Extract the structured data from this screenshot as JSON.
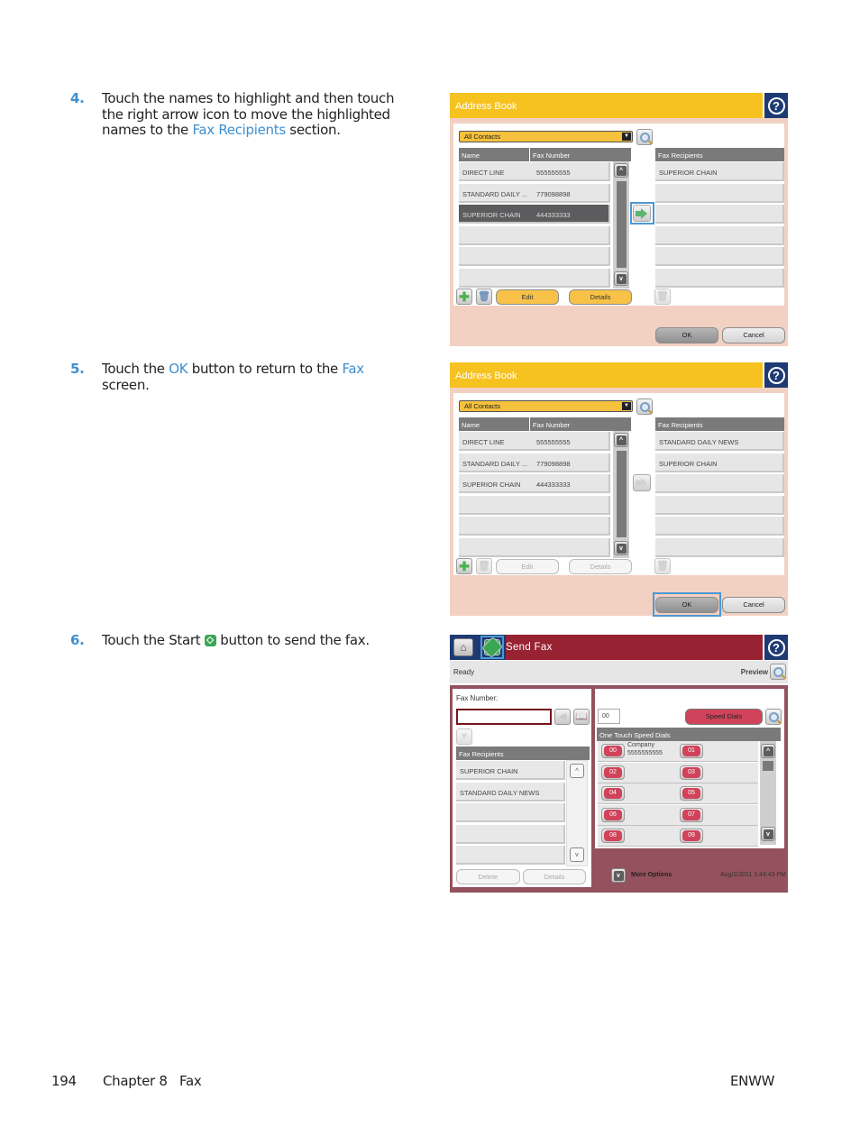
{
  "steps": [
    {
      "num": "4.",
      "parts": [
        "Touch the names to highlight and then touch the right arrow icon to move the highlighted names to the ",
        "Fax Recipients",
        " section."
      ]
    },
    {
      "num": "5.",
      "parts": [
        "Touch the ",
        "OK",
        " button to return to the ",
        "Fax",
        " screen."
      ]
    },
    {
      "num": "6.",
      "parts": [
        "Touch the Start ",
        " button to send the fax."
      ]
    }
  ],
  "footer": {
    "page": "194",
    "chapter": "Chapter 8   Fax",
    "right": "ENWW"
  },
  "address_book_1": {
    "title": "Address Book",
    "filter": "All Contacts",
    "columns": {
      "name": "Name",
      "fax": "Fax Number",
      "recipients": "Fax Recipients"
    },
    "contacts": [
      {
        "name": "DIRECT LINE",
        "fax": "555555555",
        "selected": false
      },
      {
        "name": "STANDARD DAILY ...",
        "fax": "779098898",
        "selected": false
      },
      {
        "name": "SUPERIOR CHAIN",
        "fax": "444333333",
        "selected": true
      }
    ],
    "recipients": [
      "SUPERIOR CHAIN"
    ],
    "edit": "Edit",
    "details": "Details",
    "ok": "OK",
    "cancel": "Cancel"
  },
  "address_book_2": {
    "title": "Address Book",
    "filter": "All Contacts",
    "columns": {
      "name": "Name",
      "fax": "Fax Number",
      "recipients": "Fax Recipients"
    },
    "contacts": [
      {
        "name": "DIRECT LINE",
        "fax": "555555555"
      },
      {
        "name": "STANDARD DAILY ...",
        "fax": "779098898"
      },
      {
        "name": "SUPERIOR CHAIN",
        "fax": "444333333"
      }
    ],
    "recipients": [
      "STANDARD DAILY NEWS",
      "SUPERIOR CHAIN"
    ],
    "edit": "Edit",
    "details": "Details",
    "ok": "OK",
    "cancel": "Cancel"
  },
  "send_fax": {
    "title": "Send Fax",
    "status": "Ready",
    "preview": "Preview",
    "fax_number_label": "Fax Number:",
    "fax_number_value": "",
    "speed_dial_index": "00",
    "speed_dials_button": "Speed Dials",
    "one_touch_header": "One Touch Speed Dials",
    "recipients_header": "Fax Recipients",
    "recipients": [
      "SUPERIOR CHAIN",
      "STANDARD DAILY NEWS"
    ],
    "delete": "Delete",
    "details": "Details",
    "speed_dials": [
      {
        "left": "00",
        "right": "01",
        "name": "Company",
        "number": "5555555555"
      },
      {
        "left": "02",
        "right": "03"
      },
      {
        "left": "04",
        "right": "05"
      },
      {
        "left": "06",
        "right": "07"
      },
      {
        "left": "08",
        "right": "09"
      }
    ],
    "more_options": "More Options",
    "datetime": "Aug/2/2011 1:44:43 PM"
  },
  "colors": {
    "accent": "#3e8fd0",
    "ab_title": "#f6c220",
    "fax_title": "#972232",
    "help_bg": "#1d3a73"
  }
}
